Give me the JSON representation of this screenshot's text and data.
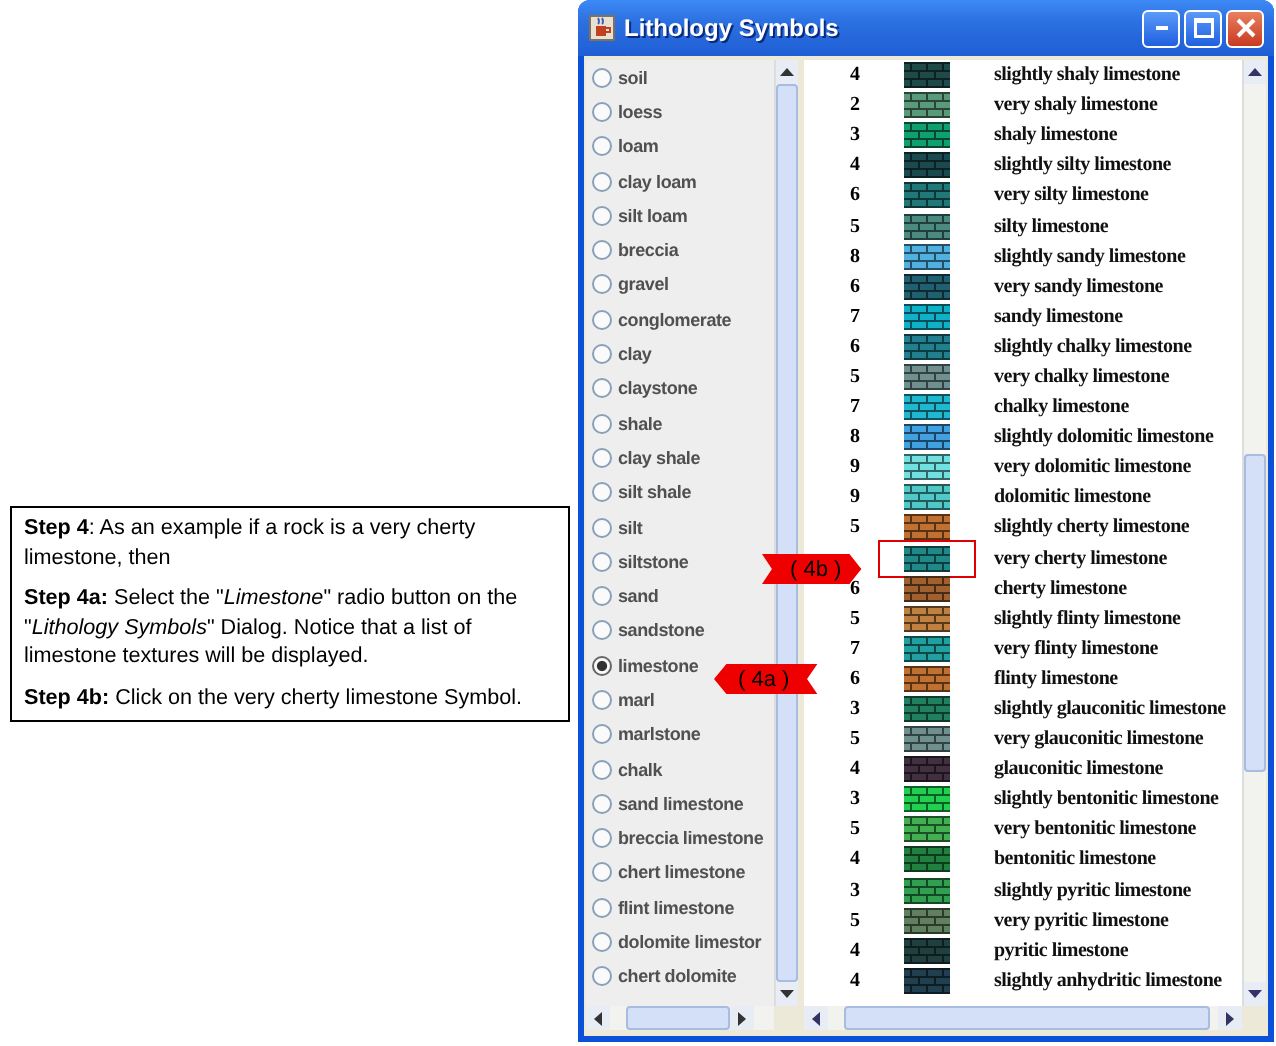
{
  "instructions": [
    "**Step 4**: As an example if a rock is a very cherty limestone, then",
    "**Step 4a:** Select the \"*Limestone*\" radio button on the \"*Lithology Symbols*\" Dialog. Notice that a list of limestone textures will be displayed.",
    "**Step 4b:** Click on the very cherty limestone Symbol."
  ],
  "callouts": [
    {
      "label": "( 4b )",
      "kind": "right"
    },
    {
      "label": "( 4a )",
      "kind": "left"
    }
  ],
  "window": {
    "title": "Lithology Symbols"
  },
  "lithologies": [
    {
      "label": "soil",
      "selected": false
    },
    {
      "label": "loess",
      "selected": false
    },
    {
      "label": "loam",
      "selected": false
    },
    {
      "label": "clay loam",
      "selected": false
    },
    {
      "label": "silt loam",
      "selected": false
    },
    {
      "label": "breccia",
      "selected": false
    },
    {
      "label": "gravel",
      "selected": false
    },
    {
      "label": "conglomerate",
      "selected": false
    },
    {
      "label": "clay",
      "selected": false
    },
    {
      "label": "claystone",
      "selected": false
    },
    {
      "label": "shale",
      "selected": false
    },
    {
      "label": "clay shale",
      "selected": false
    },
    {
      "label": "silt shale",
      "selected": false
    },
    {
      "label": "silt",
      "selected": false
    },
    {
      "label": "siltstone",
      "selected": false
    },
    {
      "label": "sand",
      "selected": false
    },
    {
      "label": "sandstone",
      "selected": false
    },
    {
      "label": "limestone",
      "selected": true
    },
    {
      "label": "marl",
      "selected": false
    },
    {
      "label": "marlstone",
      "selected": false
    },
    {
      "label": "chalk",
      "selected": false
    },
    {
      "label": "sand limestone",
      "selected": false
    },
    {
      "label": "breccia limestone",
      "selected": false
    },
    {
      "label": "chert limestone",
      "selected": false
    },
    {
      "label": "flint limestone",
      "selected": false
    },
    {
      "label": "dolomite limestor",
      "selected": false
    },
    {
      "label": "chert dolomite",
      "selected": false
    }
  ],
  "symbols": [
    {
      "number": "4",
      "color": "#1e4a4a",
      "name": "slightly shaly limestone",
      "highlighted": false
    },
    {
      "number": "2",
      "color": "#5a9a7a",
      "name": "very shaly limestone",
      "highlighted": false
    },
    {
      "number": "3",
      "color": "#10a070",
      "name": "shaly limestone",
      "highlighted": false
    },
    {
      "number": "4",
      "color": "#1a4a50",
      "name": "slightly silty limestone",
      "highlighted": false
    },
    {
      "number": "6",
      "color": "#207878",
      "name": "very silty limestone",
      "highlighted": false
    },
    {
      "number": "5",
      "color": "#4a8a80",
      "name": "silty limestone",
      "highlighted": false
    },
    {
      "number": "8",
      "color": "#50b0e0",
      "name": "slightly sandy limestone",
      "highlighted": false
    },
    {
      "number": "6",
      "color": "#206070",
      "name": "very sandy limestone",
      "highlighted": false
    },
    {
      "number": "7",
      "color": "#10b0c8",
      "name": "sandy limestone",
      "highlighted": false
    },
    {
      "number": "6",
      "color": "#208090",
      "name": "slightly chalky limestone",
      "highlighted": false
    },
    {
      "number": "5",
      "color": "#709090",
      "name": "very chalky limestone",
      "highlighted": false
    },
    {
      "number": "7",
      "color": "#20b8d0",
      "name": "chalky limestone",
      "highlighted": false
    },
    {
      "number": "8",
      "color": "#40a0e0",
      "name": "slightly dolomitic limestone",
      "highlighted": false
    },
    {
      "number": "9",
      "color": "#70e0e0",
      "name": "very dolomitic limestone",
      "highlighted": false
    },
    {
      "number": "9",
      "color": "#50c8c8",
      "name": "dolomitic limestone",
      "highlighted": false
    },
    {
      "number": "5",
      "color": "#c07030",
      "name": "slightly cherty limestone",
      "highlighted": false
    },
    {
      "color": "#208888",
      "name": "very cherty limestone",
      "highlighted": true
    },
    {
      "number": "6",
      "color": "#a06030",
      "name": "cherty limestone",
      "highlighted": false
    },
    {
      "number": "5",
      "color": "#c08040",
      "name": "slightly flinty limestone",
      "highlighted": false
    },
    {
      "number": "7",
      "color": "#20a0a0",
      "name": "very flinty limestone",
      "highlighted": false
    },
    {
      "number": "6",
      "color": "#c07030",
      "name": "flinty limestone",
      "highlighted": false
    },
    {
      "number": "3",
      "color": "#208060",
      "name": "slightly glauconitic limestone",
      "highlighted": false
    },
    {
      "number": "5",
      "color": "#709090",
      "name": "very glauconitic limestone",
      "highlighted": false
    },
    {
      "number": "4",
      "color": "#403040",
      "name": "glauconitic limestone",
      "highlighted": false
    },
    {
      "number": "3",
      "color": "#20d050",
      "name": "slightly bentonitic limestone",
      "highlighted": false
    },
    {
      "number": "5",
      "color": "#40b050",
      "name": "very bentonitic limestone",
      "highlighted": false
    },
    {
      "number": "4",
      "color": "#208040",
      "name": "bentonitic limestone",
      "highlighted": false
    },
    {
      "number": "3",
      "color": "#30a050",
      "name": "slightly pyritic limestone",
      "highlighted": false
    },
    {
      "number": "5",
      "color": "#608060",
      "name": "very pyritic limestone",
      "highlighted": false
    },
    {
      "number": "4",
      "color": "#204040",
      "name": "pyritic limestone",
      "highlighted": false
    },
    {
      "number": "4",
      "color": "#204050",
      "name": "slightly anhydritic limestone",
      "highlighted": false
    }
  ]
}
